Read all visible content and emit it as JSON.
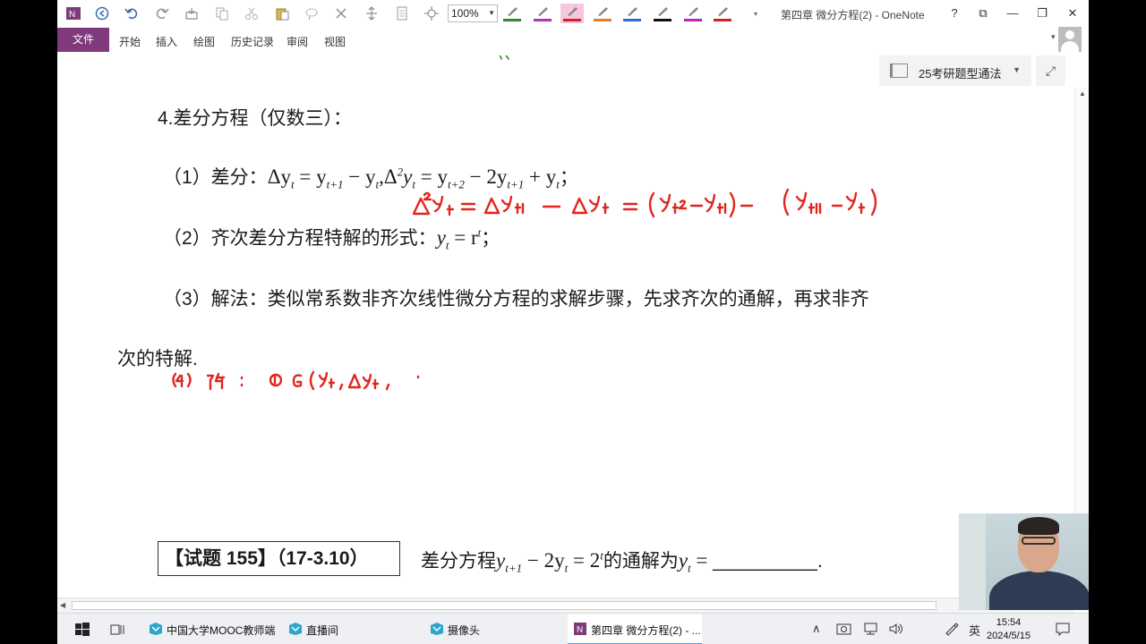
{
  "window": {
    "title": "第四章 微分方程(2) - OneNote",
    "controls": {
      "help": "?",
      "restore_ribbon": "⧉",
      "minimize": "—",
      "maximize": "❐",
      "close": "✕"
    }
  },
  "toolbar": {
    "zoom": "100%",
    "icons": [
      "onenote-icon",
      "back-icon",
      "undo-icon",
      "redo-icon",
      "dock-icon",
      "copy-icon",
      "cut-icon",
      "paste-icon",
      "lasso-icon",
      "delete-icon",
      "insert-space-icon",
      "page-icon",
      "pan-icon"
    ],
    "pens": [
      {
        "color": "#2e8b2e"
      },
      {
        "color": "#b030c0"
      },
      {
        "color": "#d42020",
        "selected": true
      },
      {
        "color": "#f07820"
      },
      {
        "color": "#2a6fd0"
      },
      {
        "color": "#111111"
      },
      {
        "color": "#c020c0"
      },
      {
        "color": "#d42020"
      }
    ]
  },
  "ribbon": {
    "file": "文件",
    "tabs": [
      "开始",
      "插入",
      "绘图",
      "历史记录",
      "审阅",
      "视图"
    ]
  },
  "notebook": {
    "name": "25考研题型通法"
  },
  "note": {
    "heading": "4.差分方程（仅数三）：",
    "item1": {
      "label": "（1）差分：",
      "f1_delta": "Δy",
      "f1_sub": "t",
      "f1_eq": " = y",
      "f1_sub2": "t+1",
      "f1_minus": " − y",
      "f1_sub3": "t",
      "f2_delta": ",Δ",
      "f2_sup": "2",
      "f2_y": "y",
      "f2_sub": "t",
      "f2_eq": " = y",
      "f2_sub2": "t+2",
      "f2_mid": " − 2y",
      "f2_sub3": "t+1",
      "f2_plus": " + y",
      "f2_sub4": "t",
      "end": "；"
    },
    "item2": {
      "label": "（2）齐次差分方程特解的形式：",
      "y": "y",
      "sub": "t",
      "eq": " = r",
      "sup": "t",
      "end": "；"
    },
    "item3": {
      "line1": "（3）解法：类似常系数非齐次线性微分方程的求解步骤，先求齐次的通解，再求非齐",
      "line2": "次的特解."
    },
    "trial": {
      "label": "【试题 155】（17-3.10）",
      "q_pre": "差分方程",
      "y1": "y",
      "s1": "t+1",
      "mid": " − 2y",
      "s2": "t",
      "eq": " = 2",
      "sup": "t",
      "q_mid": "的通解为",
      "y2": "y",
      "s3": "t",
      "eq2": " = ",
      "blank": "__________",
      "end": "."
    }
  },
  "taskbar": {
    "items": [
      {
        "label": "中国大学MOOC教师端"
      },
      {
        "label": "直播间"
      },
      {
        "label": "摄像头"
      },
      {
        "label": "第四章 微分方程(2) - ..."
      }
    ],
    "ime": "英",
    "time": "15:54",
    "date": "2024/5/15"
  }
}
